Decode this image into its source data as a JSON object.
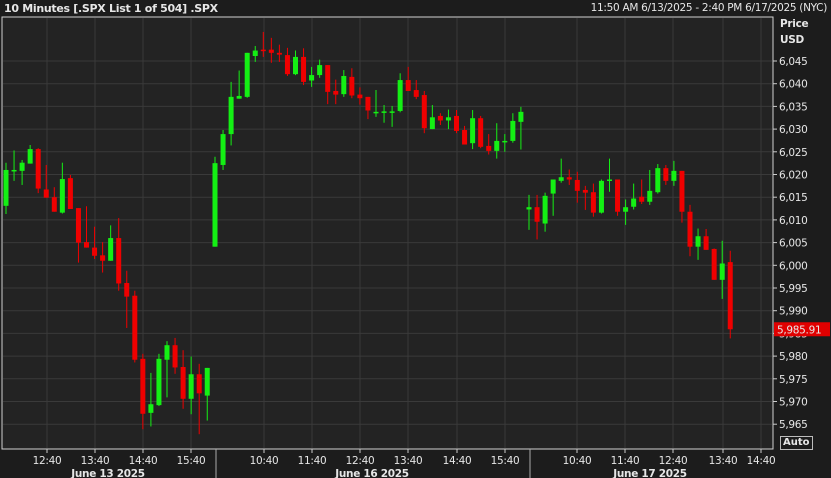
{
  "header": {
    "title": "10 Minutes [.SPX List 1 of 504] .SPX",
    "range": "11:50 AM 6/13/2025 - 2:40 PM 6/17/2025 (NYC)"
  },
  "axis": {
    "price_label": "Price",
    "currency_label": "USD",
    "auto_button": "Auto",
    "last_price": "5,985.91"
  },
  "colors": {
    "up": "#14f014",
    "down": "#f00000",
    "grid": "#3a3a3a",
    "plot_bg": "#232323",
    "last_price_bg": "#e00000"
  },
  "chart_data": {
    "type": "candlestick",
    "title": "10 Minutes [.SPX List 1 of 504] .SPX",
    "ylabel": "Price USD",
    "ylim": [
      5962,
      6053
    ],
    "yticks": [
      6045,
      6040,
      6035,
      6030,
      6025,
      6020,
      6015,
      6010,
      6005,
      6000,
      5995,
      5990,
      5985,
      5980,
      5975,
      5970,
      5965
    ],
    "ytick_labels": [
      "6,045",
      "6,040",
      "6,035",
      "6,030",
      "6,025",
      "6,020",
      "6,015",
      "6,010",
      "6,005",
      "6,000",
      "5,995",
      "5,990",
      "5,985",
      "5,980",
      "5,975",
      "5,970",
      "5,965"
    ],
    "grid": true,
    "last_price": 5985.91,
    "sessions": [
      {
        "label": "June 13 2025",
        "start": "11:50",
        "time_ticks": [
          "12:40",
          "13:40",
          "14:40",
          "15:40"
        ],
        "ohlc": [
          [
            6013.1,
            6022.6,
            6011.3,
            6021.0
          ],
          [
            6020.9,
            6025.3,
            6018.6,
            6021.0
          ],
          [
            6020.8,
            6023.2,
            6017.7,
            6022.6
          ],
          [
            6022.4,
            6026.5,
            6022.4,
            6025.6
          ],
          [
            6025.6,
            6025.8,
            6015.9,
            6016.9
          ],
          [
            6016.7,
            6022.1,
            6014.9,
            6014.9
          ],
          [
            6015.0,
            6017.2,
            6011.8,
            6011.8
          ],
          [
            6011.6,
            6022.6,
            6011.4,
            6019.0
          ],
          [
            6019.2,
            6019.9,
            6012.4,
            6012.4
          ],
          [
            6012.6,
            6012.6,
            6000.6,
            6005.0
          ],
          [
            6005.1,
            6013.0,
            6003.9,
            6003.9
          ],
          [
            6003.9,
            6008.5,
            6001.4,
            6002.1
          ],
          [
            6002.2,
            6005.1,
            5998.4,
            6001.0
          ],
          [
            6001.0,
            6008.8,
            6001.0,
            6006.0
          ],
          [
            6006.0,
            6010.4,
            5994.4,
            5996.0
          ],
          [
            5996.1,
            5998.8,
            5986.2,
            5993.1
          ],
          [
            5993.3,
            5994.4,
            5978.6,
            5979.2
          ],
          [
            5979.4,
            5980.5,
            5963.9,
            5967.3
          ],
          [
            5967.5,
            5976.3,
            5964.5,
            5969.4
          ],
          [
            5969.2,
            5980.5,
            5969.0,
            5979.4
          ],
          [
            5979.2,
            5983.3,
            5970.9,
            5982.4
          ],
          [
            5982.4,
            5984.0,
            5976.1,
            5977.5
          ],
          [
            5977.6,
            5981.3,
            5968.4,
            5970.6
          ],
          [
            5970.6,
            5979.9,
            5967.2,
            5976.0
          ],
          [
            5976.0,
            5978.3,
            5962.8,
            5971.8
          ],
          [
            5971.3,
            5977.4,
            5965.8,
            5977.4
          ]
        ]
      },
      {
        "label": "June 16 2025",
        "start": "09:30",
        "time_ticks": [
          "10:40",
          "11:40",
          "12:40",
          "13:40",
          "14:40",
          "15:40"
        ],
        "ohlc": [
          [
            6004.1,
            6023.9,
            6004.1,
            6022.5
          ],
          [
            6022.1,
            6029.8,
            6021.0,
            6028.9
          ],
          [
            6028.9,
            6040.4,
            6026.4,
            6037.1
          ],
          [
            6036.7,
            6042.9,
            6036.7,
            6037.3
          ],
          [
            6037.1,
            6046.8,
            6036.9,
            6046.8
          ],
          [
            6046.1,
            6048.3,
            6044.8,
            6047.3
          ],
          [
            6047.5,
            6051.4,
            6045.9,
            6047.3
          ],
          [
            6047.5,
            6050.1,
            6044.6,
            6046.8
          ],
          [
            6046.8,
            6048.6,
            6044.8,
            6046.4
          ],
          [
            6046.3,
            6047.9,
            6041.7,
            6042.1
          ],
          [
            6042.1,
            6047.3,
            6041.9,
            6045.9
          ],
          [
            6045.9,
            6047.8,
            6039.7,
            6040.4
          ],
          [
            6040.7,
            6043.7,
            6039.3,
            6041.9
          ],
          [
            6041.9,
            6045.3,
            6041.3,
            6044.1
          ],
          [
            6044.1,
            6044.1,
            6035.5,
            6038.2
          ],
          [
            6038.4,
            6040.9,
            6035.5,
            6037.6
          ],
          [
            6037.7,
            6043.0,
            6037.1,
            6041.7
          ],
          [
            6041.5,
            6043.4,
            6036.8,
            6037.4
          ],
          [
            6037.6,
            6039.2,
            6035.4,
            6036.8
          ],
          [
            6037.1,
            6037.1,
            6032.2,
            6034.1
          ],
          [
            6033.6,
            6038.6,
            6032.7,
            6033.8
          ],
          [
            6033.6,
            6035.3,
            6031.4,
            6033.9
          ],
          [
            6033.8,
            6035.1,
            6030.5,
            6033.9
          ],
          [
            6034.0,
            6042.3,
            6033.7,
            6040.8
          ],
          [
            6040.8,
            6043.7,
            6038.4,
            6038.4
          ],
          [
            6038.6,
            6040.8,
            6036.6,
            6037.1
          ],
          [
            6037.5,
            6038.4,
            6029.1,
            6030.2
          ],
          [
            6030.0,
            6035.3,
            6030.0,
            6032.6
          ],
          [
            6032.9,
            6033.5,
            6030.9,
            6031.9
          ],
          [
            6031.9,
            6034.3,
            6030.0,
            6032.6
          ],
          [
            6032.9,
            6034.2,
            6029.1,
            6029.6
          ],
          [
            6029.8,
            6030.7,
            6026.6,
            6026.6
          ],
          [
            6026.9,
            6034.2,
            6025.6,
            6032.4
          ],
          [
            6032.4,
            6032.9,
            6025.8,
            6026.1
          ],
          [
            6026.3,
            6028.9,
            6024.4,
            6025.2
          ],
          [
            6025.2,
            6031.3,
            6023.5,
            6027.4
          ],
          [
            6027.2,
            6028.9,
            6025.0,
            6027.4
          ],
          [
            6027.4,
            6033.5,
            6027.0,
            6031.8
          ],
          [
            6031.6,
            6034.9,
            6025.5,
            6033.8
          ]
        ]
      },
      {
        "label": "June 17 2025",
        "start": "09:30",
        "time_ticks": [
          "10:40",
          "11:40",
          "12:40",
          "13:40",
          "14:40"
        ],
        "ohlc": [
          [
            6012.3,
            6015.5,
            6007.8,
            6012.8
          ],
          [
            6012.8,
            6015.5,
            6005.7,
            6009.6
          ],
          [
            6009.2,
            6016.0,
            6007.4,
            6015.3
          ],
          [
            6015.8,
            6018.9,
            6010.9,
            6018.9
          ],
          [
            6018.6,
            6023.5,
            6018.2,
            6019.4
          ],
          [
            6019.4,
            6021.1,
            6017.7,
            6018.9
          ],
          [
            6018.8,
            6020.6,
            6013.8,
            6016.4
          ],
          [
            6016.6,
            6017.5,
            6012.2,
            6016.0
          ],
          [
            6016.1,
            6018.0,
            6010.7,
            6011.6
          ],
          [
            6011.6,
            6018.9,
            6011.4,
            6018.6
          ],
          [
            6018.6,
            6023.5,
            6016.2,
            6018.9
          ],
          [
            6018.9,
            6018.9,
            6010.9,
            6011.8
          ],
          [
            6011.8,
            6014.5,
            6008.9,
            6012.8
          ],
          [
            6012.9,
            6018.0,
            6012.3,
            6014.7
          ],
          [
            6015.1,
            6018.9,
            6013.5,
            6014.0
          ],
          [
            6014.0,
            6021.0,
            6013.3,
            6016.4
          ],
          [
            6016.1,
            6022.3,
            6015.8,
            6021.4
          ],
          [
            6021.4,
            6022.1,
            6017.7,
            6018.6
          ],
          [
            6018.6,
            6023.0,
            6017.5,
            6020.8
          ],
          [
            6020.8,
            6020.8,
            6009.4,
            6011.8
          ],
          [
            6011.8,
            6013.3,
            6002.0,
            6004.1
          ],
          [
            6004.1,
            6008.1,
            6001.2,
            6006.4
          ],
          [
            6006.4,
            6008.0,
            6003.4,
            6003.4
          ],
          [
            6003.6,
            6003.7,
            5996.8,
            5996.8
          ],
          [
            5996.8,
            6005.4,
            5992.6,
            6000.4
          ],
          [
            6000.7,
            6003.2,
            5983.9,
            5985.91
          ]
        ]
      }
    ]
  }
}
